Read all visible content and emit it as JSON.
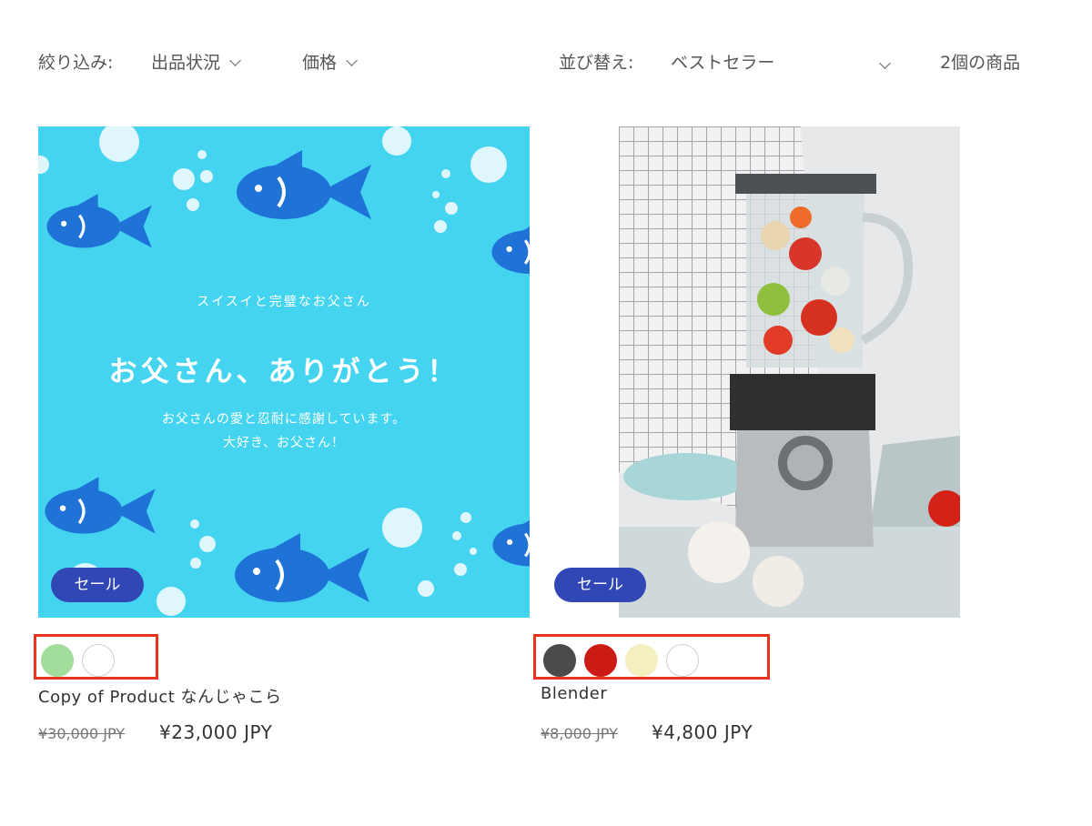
{
  "filter": {
    "label": "絞り込み:",
    "availability": "出品状況",
    "price": "価格"
  },
  "sort": {
    "label": "並び替え:",
    "value": "ベストセラー"
  },
  "product_count": "2個の商品",
  "products": [
    {
      "name": "Copy of Product なんじゃこら",
      "badge": "セール",
      "price_old": "¥30,000 JPY",
      "price_new": "¥23,000 JPY",
      "image": {
        "subtitle": "スイスイと完璧なお父さん",
        "headline": "お父さん、ありがとう！",
        "body_line1": "お父さんの愛と忍耐に感謝しています。",
        "body_line2": "大好き、お父さん！"
      },
      "swatches": [
        "#a3dd9b",
        "#ffffff"
      ]
    },
    {
      "name": "Blender",
      "badge": "セール",
      "price_old": "¥8,000 JPY",
      "price_new": "¥4,800 JPY",
      "swatches": [
        "#4a4a4a",
        "#cc1a14",
        "#f4f0c0",
        "#ffffff"
      ]
    }
  ],
  "colors": {
    "badge": "#3147b5",
    "highlight": "#e8341e",
    "poster_bg": "#45d4f0",
    "fish": "#1f72d6"
  },
  "icons": {
    "dropdown": "chevron-down-icon"
  }
}
